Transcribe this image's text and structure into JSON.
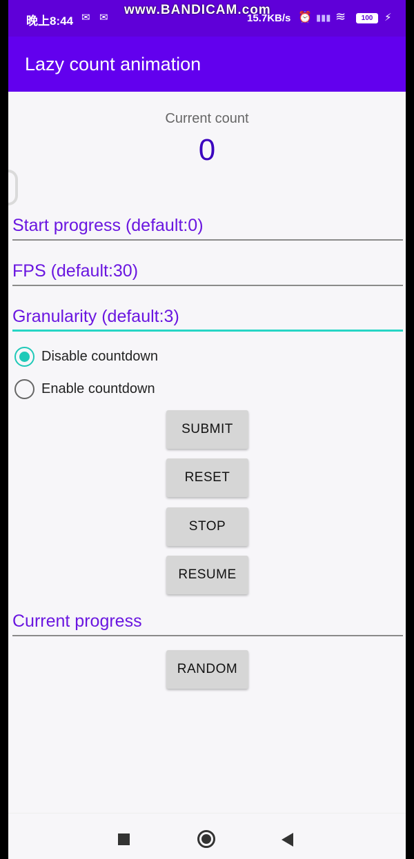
{
  "status_bar": {
    "time": "晚上8:44",
    "watermark": "www.BANDICAM.com",
    "network_speed": "15.7KB/s",
    "battery": "100"
  },
  "app_bar": {
    "title": "Lazy count animation"
  },
  "counter": {
    "label": "Current count",
    "value": "0"
  },
  "fields": {
    "start_progress": "Start progress (default:0)",
    "fps": "FPS (default:30)",
    "granularity": "Granularity (default:3)",
    "current_progress": "Current progress"
  },
  "radios": {
    "disable_countdown": "Disable countdown",
    "enable_countdown": "Enable countdown",
    "selected": "disable_countdown"
  },
  "buttons": {
    "submit": "SUBMIT",
    "reset": "RESET",
    "stop": "STOP",
    "resume": "RESUME",
    "random": "RANDOM"
  },
  "colors": {
    "app_bar": "#6200ee",
    "status_bar": "#5f00d8",
    "hint_text": "#6a16e0",
    "accent": "#26d5c5"
  }
}
